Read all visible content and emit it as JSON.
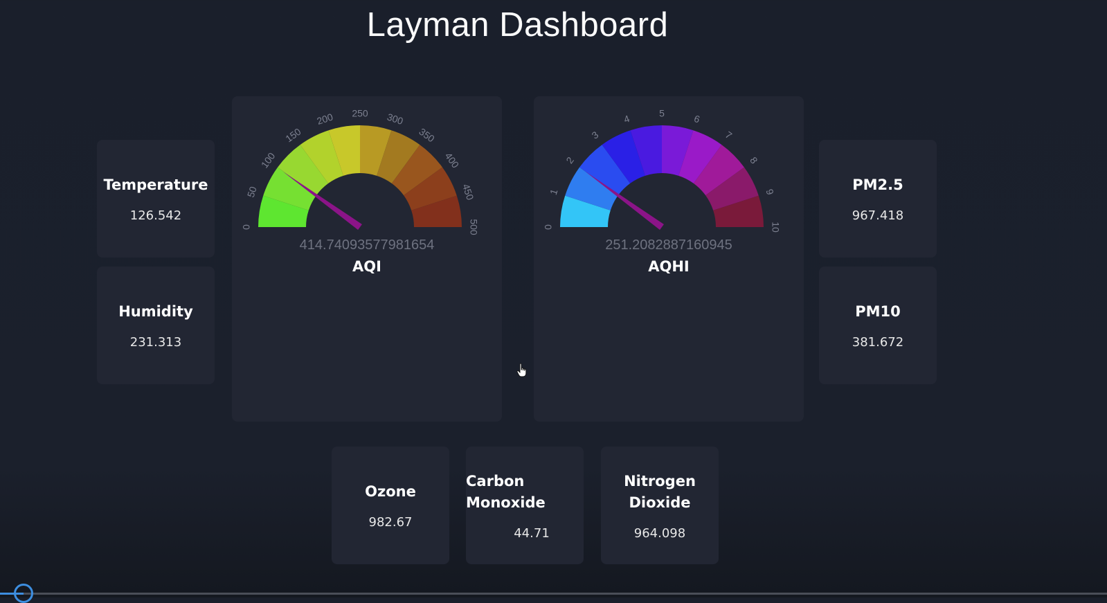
{
  "page": {
    "title": "Layman Dashboard"
  },
  "metrics": {
    "temperature": {
      "label": "Temperature",
      "value": "126.542"
    },
    "humidity": {
      "label": "Humidity",
      "value": "231.313"
    },
    "pm25": {
      "label": "PM2.5",
      "value": "967.418"
    },
    "pm10": {
      "label": "PM10",
      "value": "381.672"
    },
    "ozone": {
      "label": "Ozone",
      "value": "982.67"
    },
    "carbon_monoxide": {
      "label": "Carbon Monoxide",
      "value": "44.71"
    },
    "nitrogen_dioxide": {
      "label": "Nitrogen Dioxide",
      "value": "964.098"
    }
  },
  "gauges": {
    "aqi": {
      "title": "AQI",
      "value_text": "414.74093577981654",
      "min": 0,
      "max": 500,
      "ticks": [
        "0",
        "50",
        "100",
        "150",
        "200",
        "250",
        "300",
        "350",
        "400",
        "450",
        "500"
      ],
      "colors": [
        "#5ee630",
        "#76e032",
        "#98d831",
        "#b2d22c",
        "#c8c82a",
        "#b89a24",
        "#a37a20",
        "#99561e",
        "#8c3f1c",
        "#82301c"
      ],
      "needle_value": 99.3,
      "needle_color": "#8b1488"
    },
    "aqhi": {
      "title": "AQHI",
      "value_text": "251.2082887160945",
      "min": 0,
      "max": 10,
      "ticks": [
        "0",
        "1",
        "2",
        "3",
        "4",
        "5",
        "6",
        "7",
        "8",
        "9",
        "10"
      ],
      "colors": [
        "#33c5f7",
        "#2f7df0",
        "#2a4cf0",
        "#2a20e6",
        "#4a1ae0",
        "#7a1ad8",
        "#9a1ac8",
        "#a01a9a",
        "#8a1a6a",
        "#7a1a3a"
      ],
      "needle_value": 2.0,
      "needle_color": "#8b1488"
    }
  }
}
